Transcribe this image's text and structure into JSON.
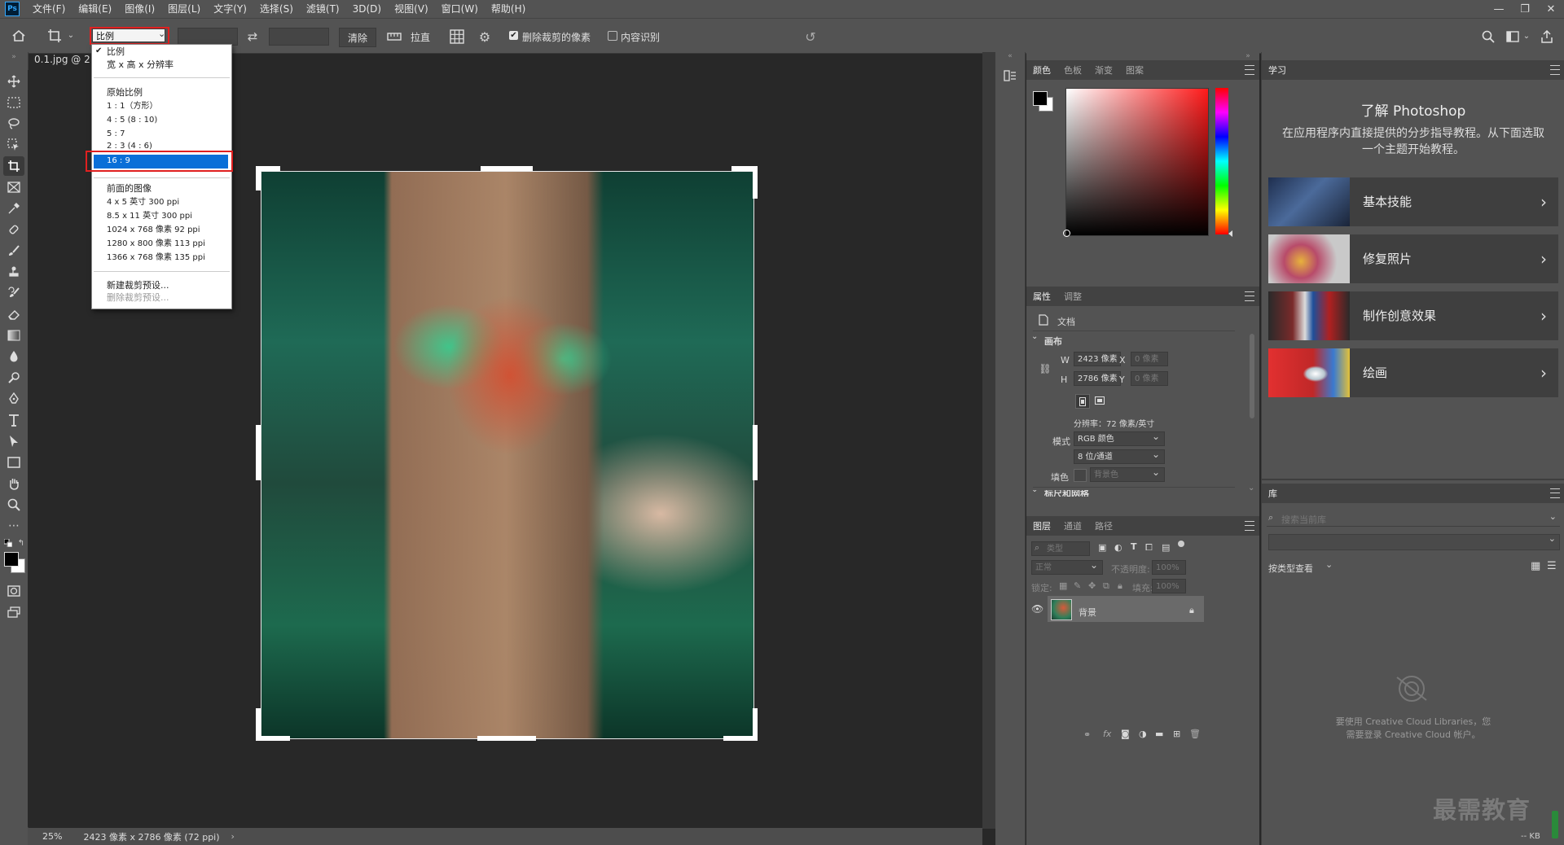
{
  "app": {
    "menu": [
      "文件(F)",
      "编辑(E)",
      "图像(I)",
      "图层(L)",
      "文字(Y)",
      "选择(S)",
      "滤镜(T)",
      "3D(D)",
      "视图(V)",
      "窗口(W)",
      "帮助(H)"
    ],
    "logo": "Ps",
    "window_controls": [
      "—",
      "❐",
      "✕"
    ]
  },
  "options_bar": {
    "ratio_select": "比例",
    "clear_label": "清除",
    "straighten_label": "拉直",
    "delete_cropped_label": "删除裁剪的像素",
    "delete_cropped_checked": true,
    "content_aware_label": "内容识别",
    "content_aware_checked": false
  },
  "ratio_dropdown": {
    "items": [
      {
        "label": "比例",
        "checked": true
      },
      {
        "label": "宽 x 高 x 分辨率"
      },
      {
        "label": "原始比例"
      },
      {
        "label": "1 : 1（方形）"
      },
      {
        "label": "4 : 5 (8 : 10)"
      },
      {
        "label": "5 : 7"
      },
      {
        "label": "2 : 3 (4 : 6)"
      },
      {
        "label": "16 : 9",
        "selected": true
      },
      {
        "label": "前面的图像"
      },
      {
        "label": "4 x 5 英寸 300 ppi"
      },
      {
        "label": "8.5 x 11 英寸 300 ppi"
      },
      {
        "label": "1024 x 768 像素 92 ppi"
      },
      {
        "label": "1280 x 800 像素 113 ppi"
      },
      {
        "label": "1366 x 768 像素 135 ppi"
      },
      {
        "label": "新建裁剪预设..."
      },
      {
        "label": "删除裁剪预设..."
      }
    ]
  },
  "document": {
    "tab_title": "0.1.jpg @ 2",
    "zoom": "25%",
    "status_info": "2423 像素 x 2786 像素 (72 ppi)",
    "status_arrow": "›"
  },
  "color_panel": {
    "tabs": [
      "颜色",
      "色板",
      "渐变",
      "图案"
    ]
  },
  "properties_panel": {
    "tabs": [
      "属性",
      "调整"
    ],
    "doc_label": "文档",
    "canvas_section": "画布",
    "w_label": "W",
    "w_value": "2423 像素",
    "h_label": "H",
    "h_value": "2786 像素",
    "x_label": "X",
    "x_placeholder": "0 像素",
    "y_label": "Y",
    "y_placeholder": "0 像素",
    "resolution": "分辨率：72 像素/英寸",
    "mode_label": "模式",
    "mode_value": "RGB 颜色",
    "depth_value": "8 位/通道",
    "fill_label": "填色",
    "fill_value": "背景色",
    "next_section": "标尺和网格"
  },
  "layers_panel": {
    "tabs": [
      "图层",
      "通道",
      "路径"
    ],
    "filter_placeholder": "类型",
    "blend_mode": "正常",
    "opacity_label": "不透明度:",
    "opacity_value": "100%",
    "lock_label": "锁定:",
    "fill_label": "填充:",
    "fill_value": "100%",
    "layer_name": "背景"
  },
  "learn_panel": {
    "tab": "学习",
    "title": "了解 Photoshop",
    "description": "在应用程序内直接提供的分步指导教程。从下面选取一个主题开始教程。",
    "cards": [
      {
        "label": "基本技能"
      },
      {
        "label": "修复照片"
      },
      {
        "label": "制作创意效果"
      },
      {
        "label": "绘画"
      }
    ]
  },
  "library_panel": {
    "tab": "库",
    "search_placeholder": "搜索当前库",
    "view_by": "按类型查看",
    "cloud_message_line1": "要使用 Creative Cloud Libraries，您",
    "cloud_message_line2": "需要登录 Creative Cloud 帐户。",
    "kb_label": "-- KB"
  },
  "watermark": "最需教育"
}
